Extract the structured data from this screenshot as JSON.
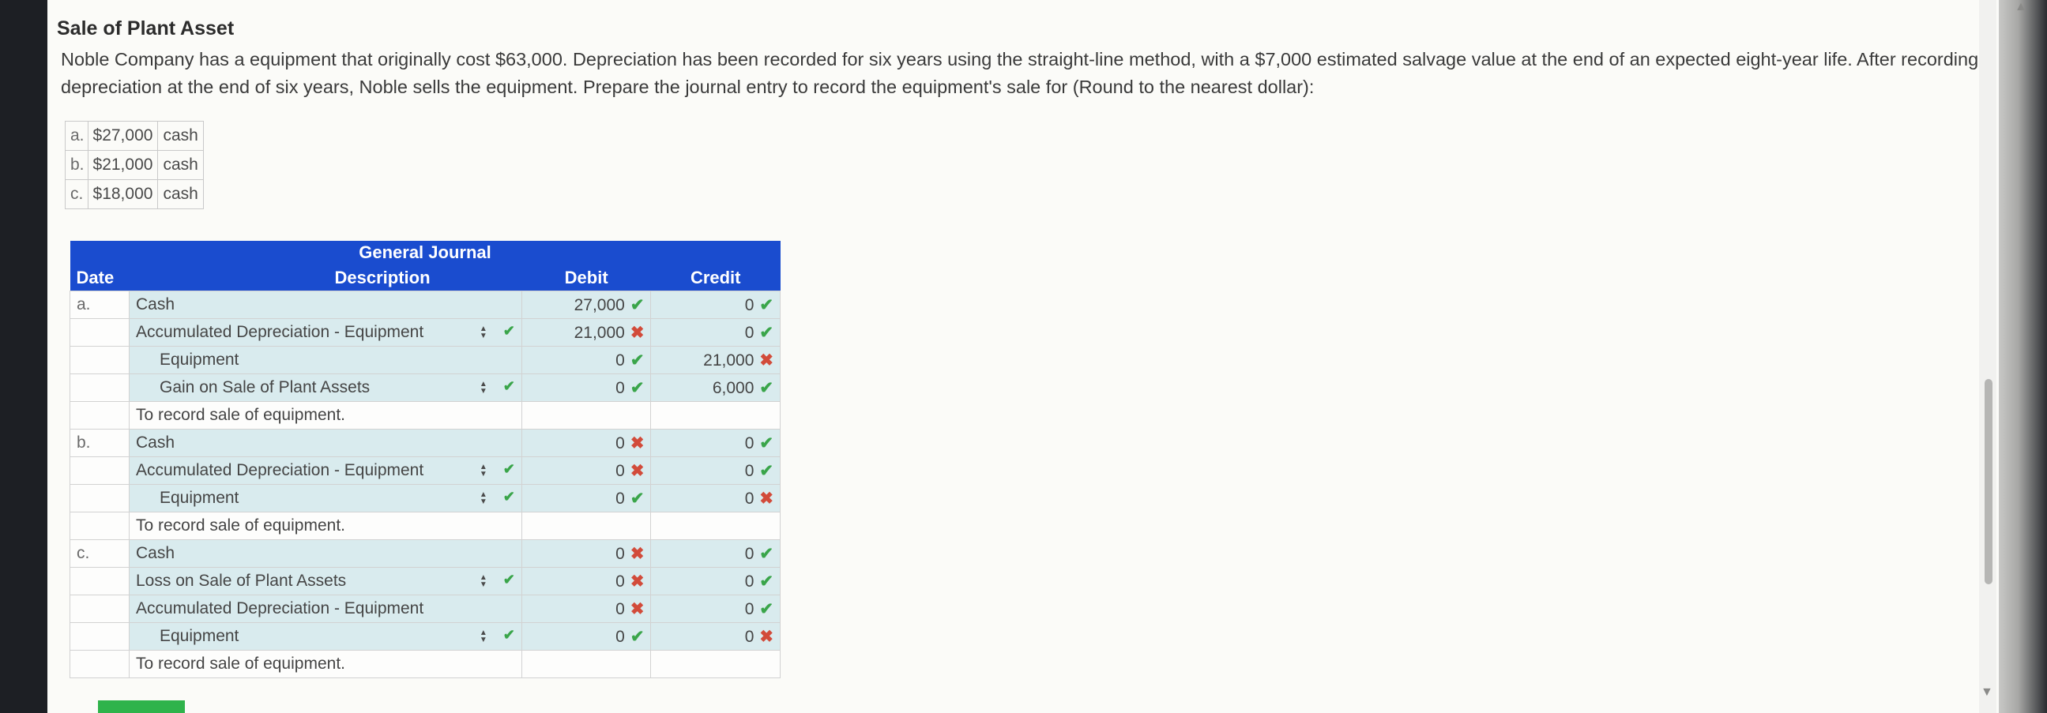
{
  "title": "Sale of Plant Asset",
  "problem": "Noble Company has a equipment that originally cost $63,000. Depreciation has been recorded for six years using the straight-line method, with a $7,000 estimated salvage value at the end of an expected eight-year life. After recording depreciation at the end of six years, Noble sells the equipment. Prepare the journal entry to record the equipment's sale for (Round to the nearest dollar):",
  "options": [
    {
      "letter": "a.",
      "amount": "$27,000",
      "unit": "cash"
    },
    {
      "letter": "b.",
      "amount": "$21,000",
      "unit": "cash"
    },
    {
      "letter": "c.",
      "amount": "$18,000",
      "unit": "cash"
    }
  ],
  "journal": {
    "title": "General Journal",
    "headers": {
      "date": "Date",
      "description": "Description",
      "debit": "Debit",
      "credit": "Credit"
    },
    "marks": {
      "ok": "✔",
      "bad": "✖"
    },
    "rows": [
      {
        "date": "a.",
        "desc": "Cash",
        "indent": false,
        "dropdown": false,
        "debit": "27,000",
        "debit_status": "ok",
        "credit": "0",
        "credit_status": "ok"
      },
      {
        "date": "",
        "desc": "Accumulated Depreciation - Equipment",
        "indent": false,
        "dropdown": true,
        "debit": "21,000",
        "debit_status": "bad",
        "credit": "0",
        "credit_status": "ok"
      },
      {
        "date": "",
        "desc": "Equipment",
        "indent": true,
        "dropdown": false,
        "debit": "0",
        "debit_status": "ok",
        "credit": "21,000",
        "credit_status": "bad"
      },
      {
        "date": "",
        "desc": "Gain on Sale of Plant Assets",
        "indent": true,
        "dropdown": true,
        "debit": "0",
        "debit_status": "ok",
        "credit": "6,000",
        "credit_status": "ok"
      },
      {
        "date": "",
        "desc": "To record sale of equipment.",
        "indent": false,
        "dropdown": false,
        "memo": true,
        "debit": "",
        "debit_status": "",
        "credit": "",
        "credit_status": ""
      },
      {
        "date": "b.",
        "desc": "Cash",
        "indent": false,
        "dropdown": false,
        "debit": "0",
        "debit_status": "bad",
        "credit": "0",
        "credit_status": "ok"
      },
      {
        "date": "",
        "desc": "Accumulated Depreciation - Equipment",
        "indent": false,
        "dropdown": true,
        "debit": "0",
        "debit_status": "bad",
        "credit": "0",
        "credit_status": "ok"
      },
      {
        "date": "",
        "desc": "Equipment",
        "indent": true,
        "dropdown": true,
        "debit": "0",
        "debit_status": "ok",
        "credit": "0",
        "credit_status": "bad"
      },
      {
        "date": "",
        "desc": "To record sale of equipment.",
        "indent": false,
        "dropdown": false,
        "memo": true,
        "debit": "",
        "debit_status": "",
        "credit": "",
        "credit_status": ""
      },
      {
        "date": "c.",
        "desc": "Cash",
        "indent": false,
        "dropdown": false,
        "debit": "0",
        "debit_status": "bad",
        "credit": "0",
        "credit_status": "ok"
      },
      {
        "date": "",
        "desc": "Loss on Sale of Plant Assets",
        "indent": false,
        "dropdown": true,
        "debit": "0",
        "debit_status": "bad",
        "credit": "0",
        "credit_status": "ok"
      },
      {
        "date": "",
        "desc": "Accumulated Depreciation - Equipment",
        "indent": false,
        "dropdown": false,
        "debit": "0",
        "debit_status": "bad",
        "credit": "0",
        "credit_status": "ok"
      },
      {
        "date": "",
        "desc": "Equipment",
        "indent": true,
        "dropdown": true,
        "debit": "0",
        "debit_status": "ok",
        "credit": "0",
        "credit_status": "bad"
      },
      {
        "date": "",
        "desc": "To record sale of equipment.",
        "indent": false,
        "dropdown": false,
        "memo": true,
        "debit": "",
        "debit_status": "",
        "credit": "",
        "credit_status": ""
      }
    ]
  },
  "colors": {
    "header_blue": "#1a4ccf",
    "ok_green": "#3aa54a",
    "bad_red": "#d24b3a",
    "row_shade": "#d9ebee",
    "button_green": "#2fb34b"
  }
}
